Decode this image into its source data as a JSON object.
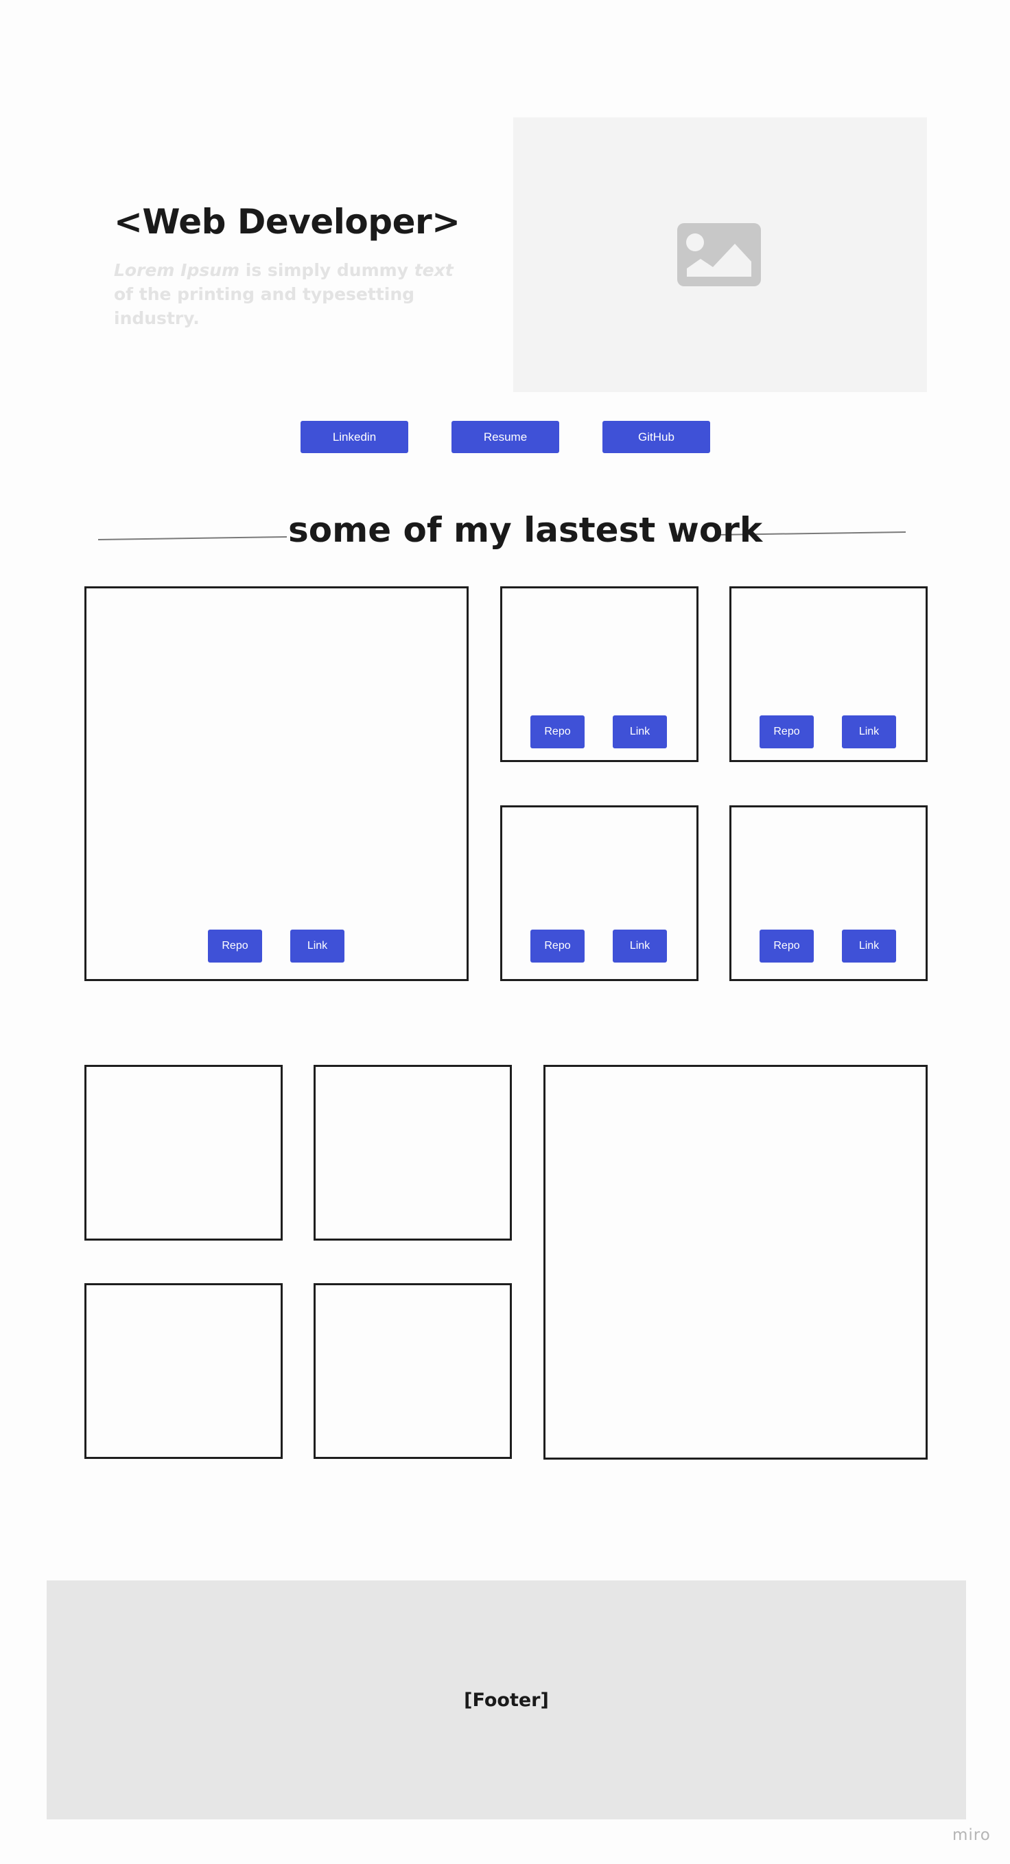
{
  "hero": {
    "title": "<Web Developer>",
    "subtitle_lorem": "Lorem Ipsum",
    "subtitle_part1": " is simply dummy ",
    "subtitle_text": "text",
    "subtitle_part2": " of the printing and typesetting industry.",
    "image_icon": "image-placeholder-icon"
  },
  "nav_buttons": {
    "linkedin": "Linkedin",
    "resume": "Resume",
    "github": "GitHub"
  },
  "section": {
    "title": "some of my lastest work"
  },
  "card_buttons": {
    "repo": "Repo",
    "link": "Link"
  },
  "footer": {
    "label": "[Footer]"
  },
  "watermark": "miro",
  "colors": {
    "button": "#3f51d7",
    "footer_bg": "#e6e6e6",
    "image_bg": "#f3f3f3",
    "card_border": "#1e1e1e"
  }
}
